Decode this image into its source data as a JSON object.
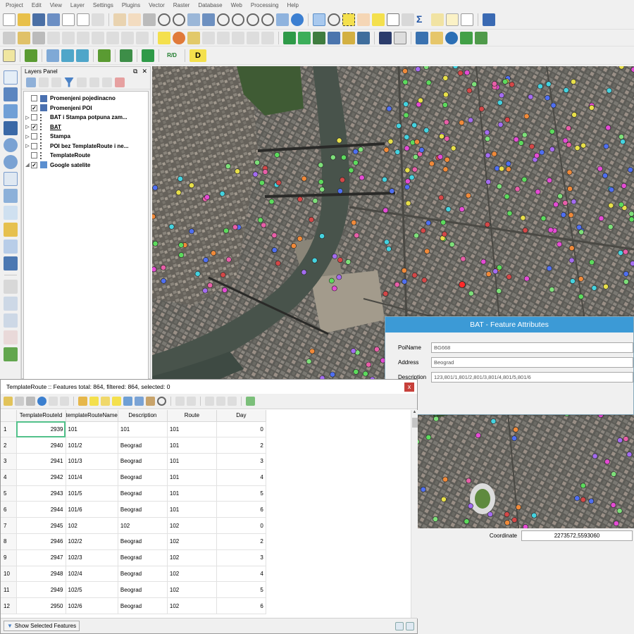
{
  "menu": [
    "Project",
    "Edit",
    "View",
    "Layer",
    "Settings",
    "Plugins",
    "Vector",
    "Raster",
    "Database",
    "Web",
    "Processing",
    "Help"
  ],
  "toolbar3": {
    "rd_label": "R/D",
    "d_label": "D"
  },
  "layers_panel": {
    "title": "Layers Panel",
    "layers": [
      {
        "name": "Promenjeni pojedinacno",
        "checked": false,
        "expandable": false
      },
      {
        "name": "Promenjeni POI",
        "checked": true,
        "expandable": false
      },
      {
        "name": "BAT i Stampa potpuna zam...",
        "checked": false,
        "expandable": true
      },
      {
        "name": "BAT",
        "checked": true,
        "expandable": true,
        "selected": true
      },
      {
        "name": "Stampa",
        "checked": false,
        "expandable": true
      },
      {
        "name": "POI bez TemplateRoute i ne...",
        "checked": false,
        "expandable": true
      },
      {
        "name": "TemplateRoute",
        "checked": false,
        "expandable": false
      },
      {
        "name": "Google satelite",
        "checked": true,
        "expandable": true
      }
    ]
  },
  "feature_attributes": {
    "title": "BAT - Feature Attributes",
    "fields": [
      {
        "label": "PoiName",
        "value": "BG668"
      },
      {
        "label": "Address",
        "value": "Beograd"
      },
      {
        "label": "Description",
        "value": "123,801/1,801/2,801/3,801/4,801/5,801/6"
      }
    ]
  },
  "status": {
    "coordinate_label": "Coordinate",
    "coordinate_value": "2273572,5593060"
  },
  "attribute_table": {
    "title": "TemplateRoute :: Features total: 864, filtered: 864, selected: 0",
    "close": "x",
    "columns": [
      "TemplateRouteId",
      "templateRouteName",
      "Description",
      "Route",
      "Day"
    ],
    "rows": [
      [
        "1",
        "2939",
        "101",
        "101",
        "101",
        "0"
      ],
      [
        "2",
        "2940",
        "101/2",
        "Beograd",
        "101",
        "2"
      ],
      [
        "3",
        "2941",
        "101/3",
        "Beograd",
        "101",
        "3"
      ],
      [
        "4",
        "2942",
        "101/4",
        "Beograd",
        "101",
        "4"
      ],
      [
        "5",
        "2943",
        "101/5",
        "Beograd",
        "101",
        "5"
      ],
      [
        "6",
        "2944",
        "101/6",
        "Beograd",
        "101",
        "6"
      ],
      [
        "7",
        "2945",
        "102",
        "102",
        "102",
        "0"
      ],
      [
        "8",
        "2946",
        "102/2",
        "Beograd",
        "102",
        "2"
      ],
      [
        "9",
        "2947",
        "102/3",
        "Beograd",
        "102",
        "3"
      ],
      [
        "10",
        "2948",
        "102/4",
        "Beograd",
        "102",
        "4"
      ],
      [
        "11",
        "2949",
        "102/5",
        "Beograd",
        "102",
        "5"
      ],
      [
        "12",
        "2950",
        "102/6",
        "Beograd",
        "102",
        "6"
      ]
    ],
    "footer_button": "Show Selected Features"
  },
  "colors": {
    "title_bar": "#3c9ad6",
    "close_button": "#c7403a",
    "current_cell": "#52c18a"
  }
}
